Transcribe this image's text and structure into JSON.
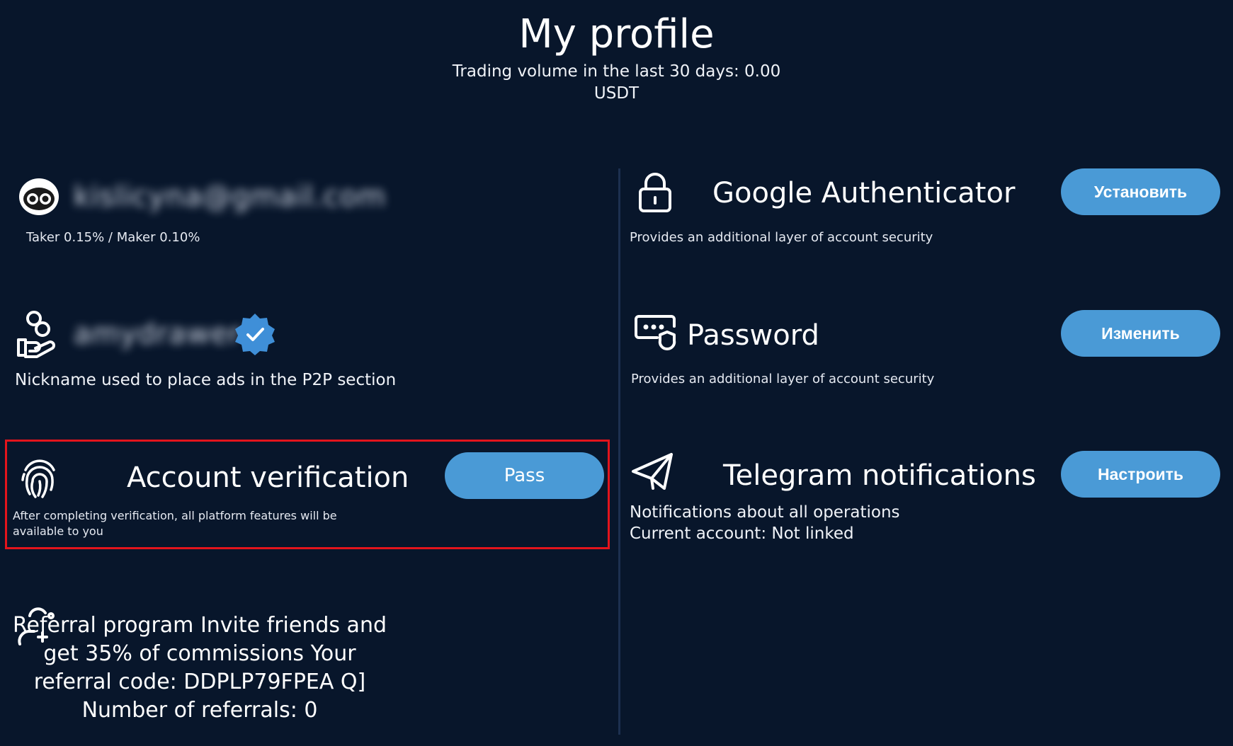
{
  "header": {
    "title": "My profile",
    "trading_volume": "Trading volume in the last 30 days: 0.00 USDT"
  },
  "account": {
    "email": "kislicyna@gmail.com",
    "fees": "Taker 0.15% / Maker 0.10%"
  },
  "nickname": {
    "value": "amydrawer",
    "description": "Nickname used to place ads in the P2P section"
  },
  "verification": {
    "title": "Account verification",
    "button": "Pass",
    "description": "After completing verification, all platform features will be available to you"
  },
  "referral": {
    "text": "Referral program Invite friends and get 35% of commissions Your referral code: DDPLP79FPEA Q] Number of referrals: 0"
  },
  "google_auth": {
    "title": "Google Authenticator",
    "button": "Установить",
    "description": "Provides an additional layer of account security"
  },
  "password": {
    "title": "Password",
    "button": "Изменить",
    "description": "Provides an additional layer of account security"
  },
  "telegram": {
    "title": "Telegram notifications",
    "button": "Настроить",
    "line1": "Notifications about all operations",
    "line2": "Current account: Not linked"
  },
  "colors": {
    "background": "#08162b",
    "button": "#4a9ad6",
    "highlight": "#e3141c",
    "verified_badge": "#3f8fd8"
  },
  "icons": [
    "avatar-icon",
    "coins-hand-icon",
    "verified-badge-icon",
    "fingerprint-icon",
    "referral-icon",
    "lock-icon",
    "password-shield-icon",
    "send-plane-icon"
  ]
}
